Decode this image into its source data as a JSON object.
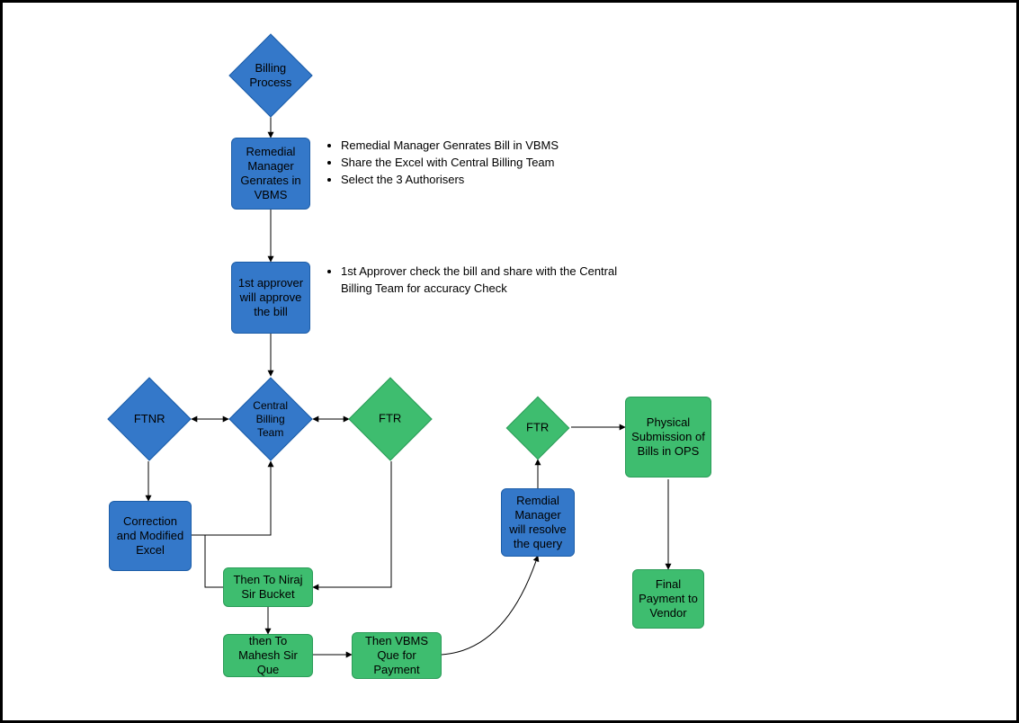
{
  "diagram": {
    "title": "Billing Process",
    "nodes": {
      "billing_process": "Billing Process",
      "remedial_manager_generates": "Remedial Manager Genrates in VBMS",
      "first_approver": "1st approver will approve the bill",
      "central_billing_team": "Central Billing Team",
      "ftnr": "FTNR",
      "ftr1": "FTR",
      "correction_excel": "Correction and Modified Excel",
      "niraj_bucket": "Then To Niraj Sir Bucket",
      "mahesh_que": "then To Mahesh Sir Que",
      "vbms_que_payment": "Then VBMS Que for Payment",
      "resolve_query": "Remdial Manager will resolve the query",
      "ftr2": "FTR",
      "physical_submission": "Physical Submission of Bills in OPS",
      "final_payment": "Final Payment to Vendor"
    },
    "annotations": {
      "a1": {
        "items": [
          "Remedial Manager Genrates Bill in VBMS",
          "Share the Excel with Central Billing Team",
          "Select the 3 Authorisers"
        ]
      },
      "a2": {
        "items": [
          "1st Approver check the bill and share with the Central Billing Team for accuracy Check"
        ]
      }
    }
  }
}
